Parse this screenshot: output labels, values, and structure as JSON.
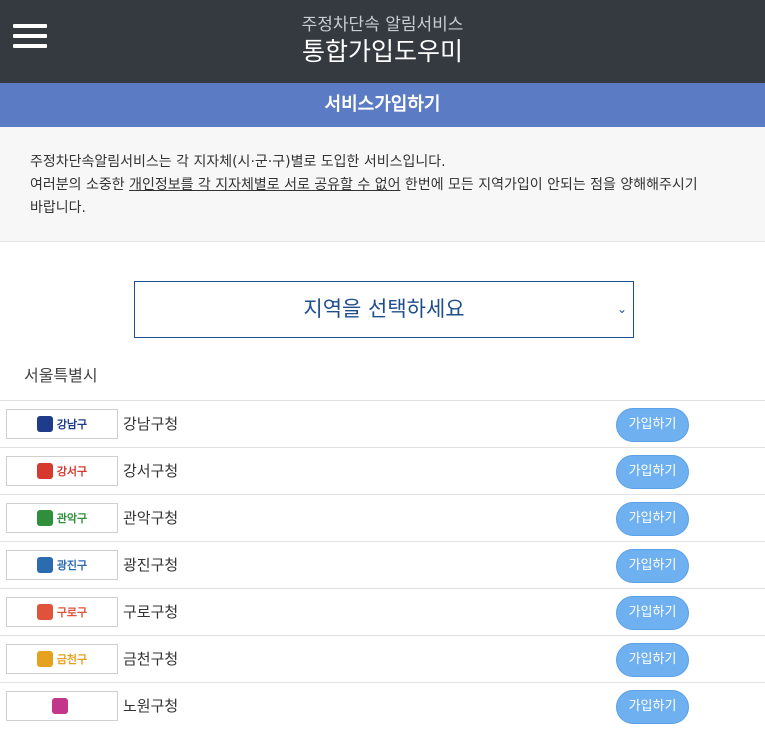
{
  "header": {
    "subtitle": "주정차단속 알림서비스",
    "title": "통합가입도우미",
    "bg_color": "#343a40"
  },
  "section": {
    "title": "서비스가입하기",
    "color": "#5b7bc4"
  },
  "notice": {
    "line1": "주정차단속알림서비스는 각 지자체(시·군·구)별로 도입한 서비스입니다.",
    "line2_prefix": "여러분의 소중한 ",
    "line2_underlined": "개인정보를 각 지자체별로 서로 공유할 수 없어",
    "line2_suffix": " 한번에 모든 지역가입이 안되는 점을 양해해주시기",
    "line3": "바랍니다."
  },
  "region_select": {
    "selected": "지역을 선택하세요",
    "chevron": "⌄"
  },
  "region": {
    "title": "서울특별시",
    "districts": [
      {
        "logo": "강남구",
        "name": "강남구청",
        "button": "가입하기",
        "color": "#1f3b8c"
      },
      {
        "logo": "강서구",
        "name": "강서구청",
        "button": "가입하기",
        "color": "#d63a2f"
      },
      {
        "logo": "관악구",
        "name": "관악구청",
        "button": "가입하기",
        "color": "#2f8f3c"
      },
      {
        "logo": "광진구",
        "name": "광진구청",
        "button": "가입하기",
        "color": "#2b6cb0"
      },
      {
        "logo": "구로구",
        "name": "구로구청",
        "button": "가입하기",
        "color": "#e0523a"
      },
      {
        "logo": "금천구",
        "name": "금천구청",
        "button": "가입하기",
        "color": "#e6a21f"
      },
      {
        "logo": "",
        "name": "노원구청",
        "button": "가입하기",
        "color": "#c2378a"
      }
    ]
  },
  "accent_button_color": "#6fb0f0"
}
